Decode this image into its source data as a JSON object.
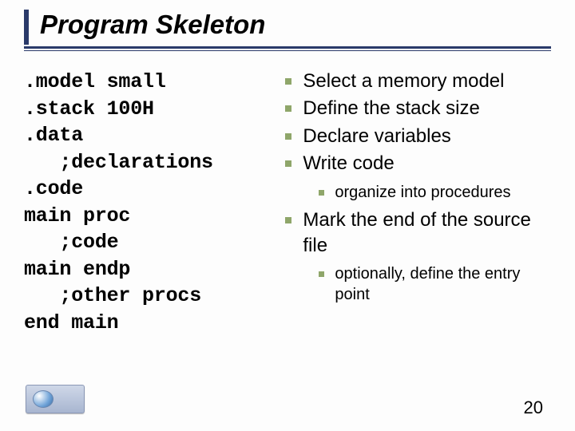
{
  "title": "Program Skeleton",
  "code_lines": [
    ".model small",
    ".stack 100H",
    ".data",
    "   ;declarations",
    ".code",
    "main proc",
    "   ;code",
    "main endp",
    "   ;other procs",
    "end main"
  ],
  "bullets": [
    {
      "text": "Select a memory model",
      "sub": []
    },
    {
      "text": "Define the stack size",
      "sub": []
    },
    {
      "text": "Declare variables",
      "sub": []
    },
    {
      "text": "Write code",
      "sub": [
        "organize into procedures"
      ]
    },
    {
      "text": "Mark the end of the source file",
      "sub": [
        "optionally, define the entry point"
      ]
    }
  ],
  "page_number": "20"
}
